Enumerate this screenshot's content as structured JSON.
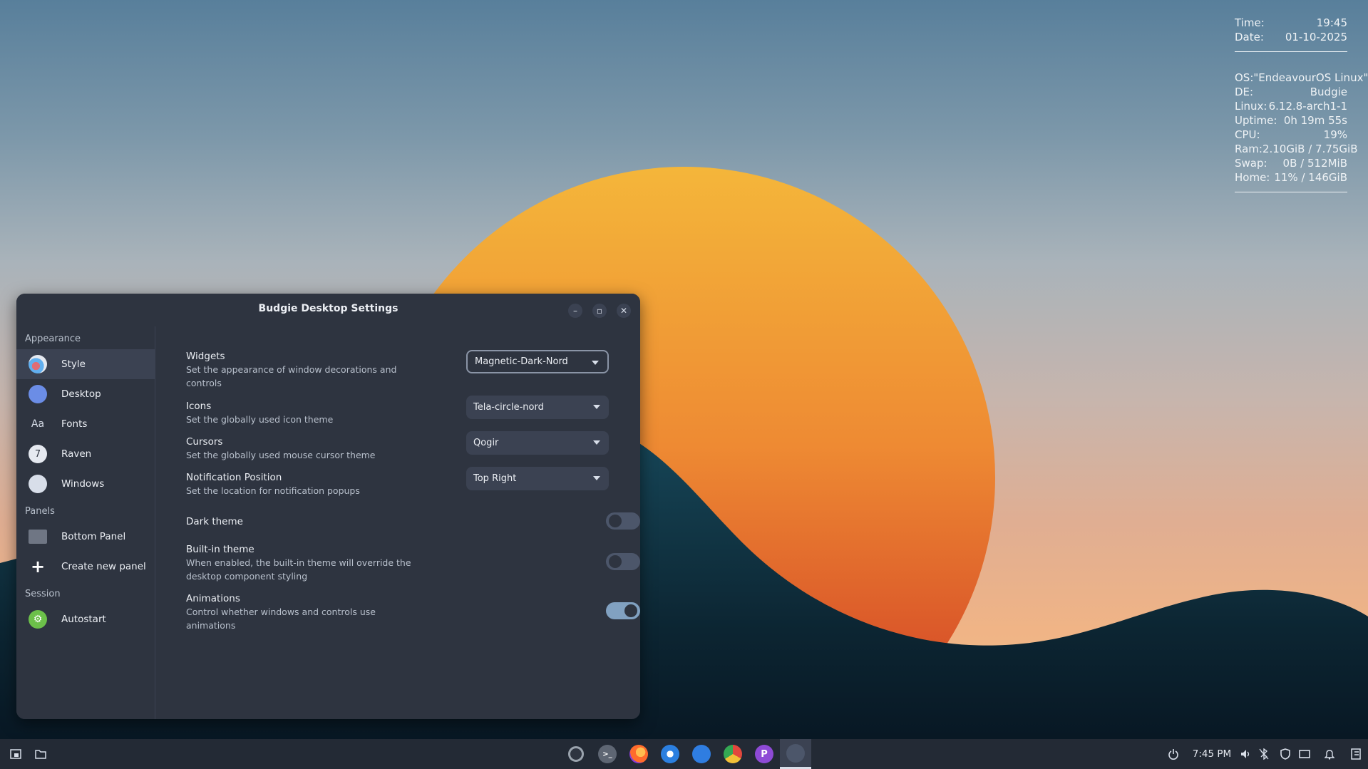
{
  "conky": {
    "time_label": "Time:",
    "time_value": "19:45",
    "date_label": "Date:",
    "date_value": "01-10-2025",
    "os_line": "OS:\"EndeavourOS Linux\"",
    "rows": [
      {
        "label": "DE:",
        "value": "Budgie"
      },
      {
        "label": "Linux:",
        "value": "6.12.8-arch1-1"
      },
      {
        "label": "Uptime:",
        "value": "0h 19m 55s"
      },
      {
        "label": "CPU:",
        "value": "19%"
      },
      {
        "label": "Ram:",
        "value": "2.10GiB / 7.75GiB"
      },
      {
        "label": "Swap:",
        "value": "0B / 512MiB"
      },
      {
        "label": "Home:",
        "value": "11% / 146GiB"
      }
    ]
  },
  "window": {
    "title": "Budgie Desktop Settings",
    "minimize_glyph": "–",
    "maximize_glyph": "▫",
    "close_glyph": "✕"
  },
  "sidebar": {
    "sections": [
      {
        "header": "Appearance",
        "items": [
          {
            "label": "Style",
            "icon": "style-icon",
            "active": true
          },
          {
            "label": "Desktop",
            "icon": "desktop-icon"
          },
          {
            "label": "Fonts",
            "icon": "fonts-icon",
            "glyph": "Aa"
          },
          {
            "label": "Raven",
            "icon": "raven-icon",
            "glyph": "7"
          },
          {
            "label": "Windows",
            "icon": "windows-icon"
          }
        ]
      },
      {
        "header": "Panels",
        "items": [
          {
            "label": "Bottom Panel",
            "icon": "panel-icon"
          },
          {
            "label": "Create new panel",
            "icon": "plus-icon",
            "glyph": "+"
          }
        ]
      },
      {
        "header": "Session",
        "items": [
          {
            "label": "Autostart",
            "icon": "autostart-icon",
            "glyph": "⚙"
          }
        ]
      }
    ]
  },
  "settings": {
    "widgets": {
      "name": "Widgets",
      "desc": "Set the appearance of window decorations and controls",
      "value": "Magnetic-Dark-Nord"
    },
    "icons": {
      "name": "Icons",
      "desc": "Set the globally used icon theme",
      "value": "Tela-circle-nord"
    },
    "cursors": {
      "name": "Cursors",
      "desc": "Set the globally used mouse cursor theme",
      "value": "Qogir"
    },
    "notification": {
      "name": "Notification Position",
      "desc": "Set the location for notification popups",
      "value": "Top Right"
    },
    "dark_theme": {
      "name": "Dark theme",
      "enabled": false
    },
    "builtin_theme": {
      "name": "Built-in theme",
      "desc": "When enabled, the built-in theme will override the desktop component styling",
      "enabled": false
    },
    "animations": {
      "name": "Animations",
      "desc": "Control whether windows and controls use animations",
      "enabled": true
    }
  },
  "taskbar": {
    "clock": "7:45 PM",
    "apps": [
      "record-app-icon",
      "terminal-app-icon",
      "firefox-app-icon",
      "thunderbird-app-icon",
      "updater-app-icon",
      "browser-app-icon",
      "pcloud-app-icon",
      "settings-app-icon"
    ],
    "pcloud_glyph": "P",
    "terminal_glyph": ">_"
  },
  "colors": {
    "accent": "#81a1c1",
    "window_bg": "#2e3440",
    "sun": "#e8782e"
  }
}
